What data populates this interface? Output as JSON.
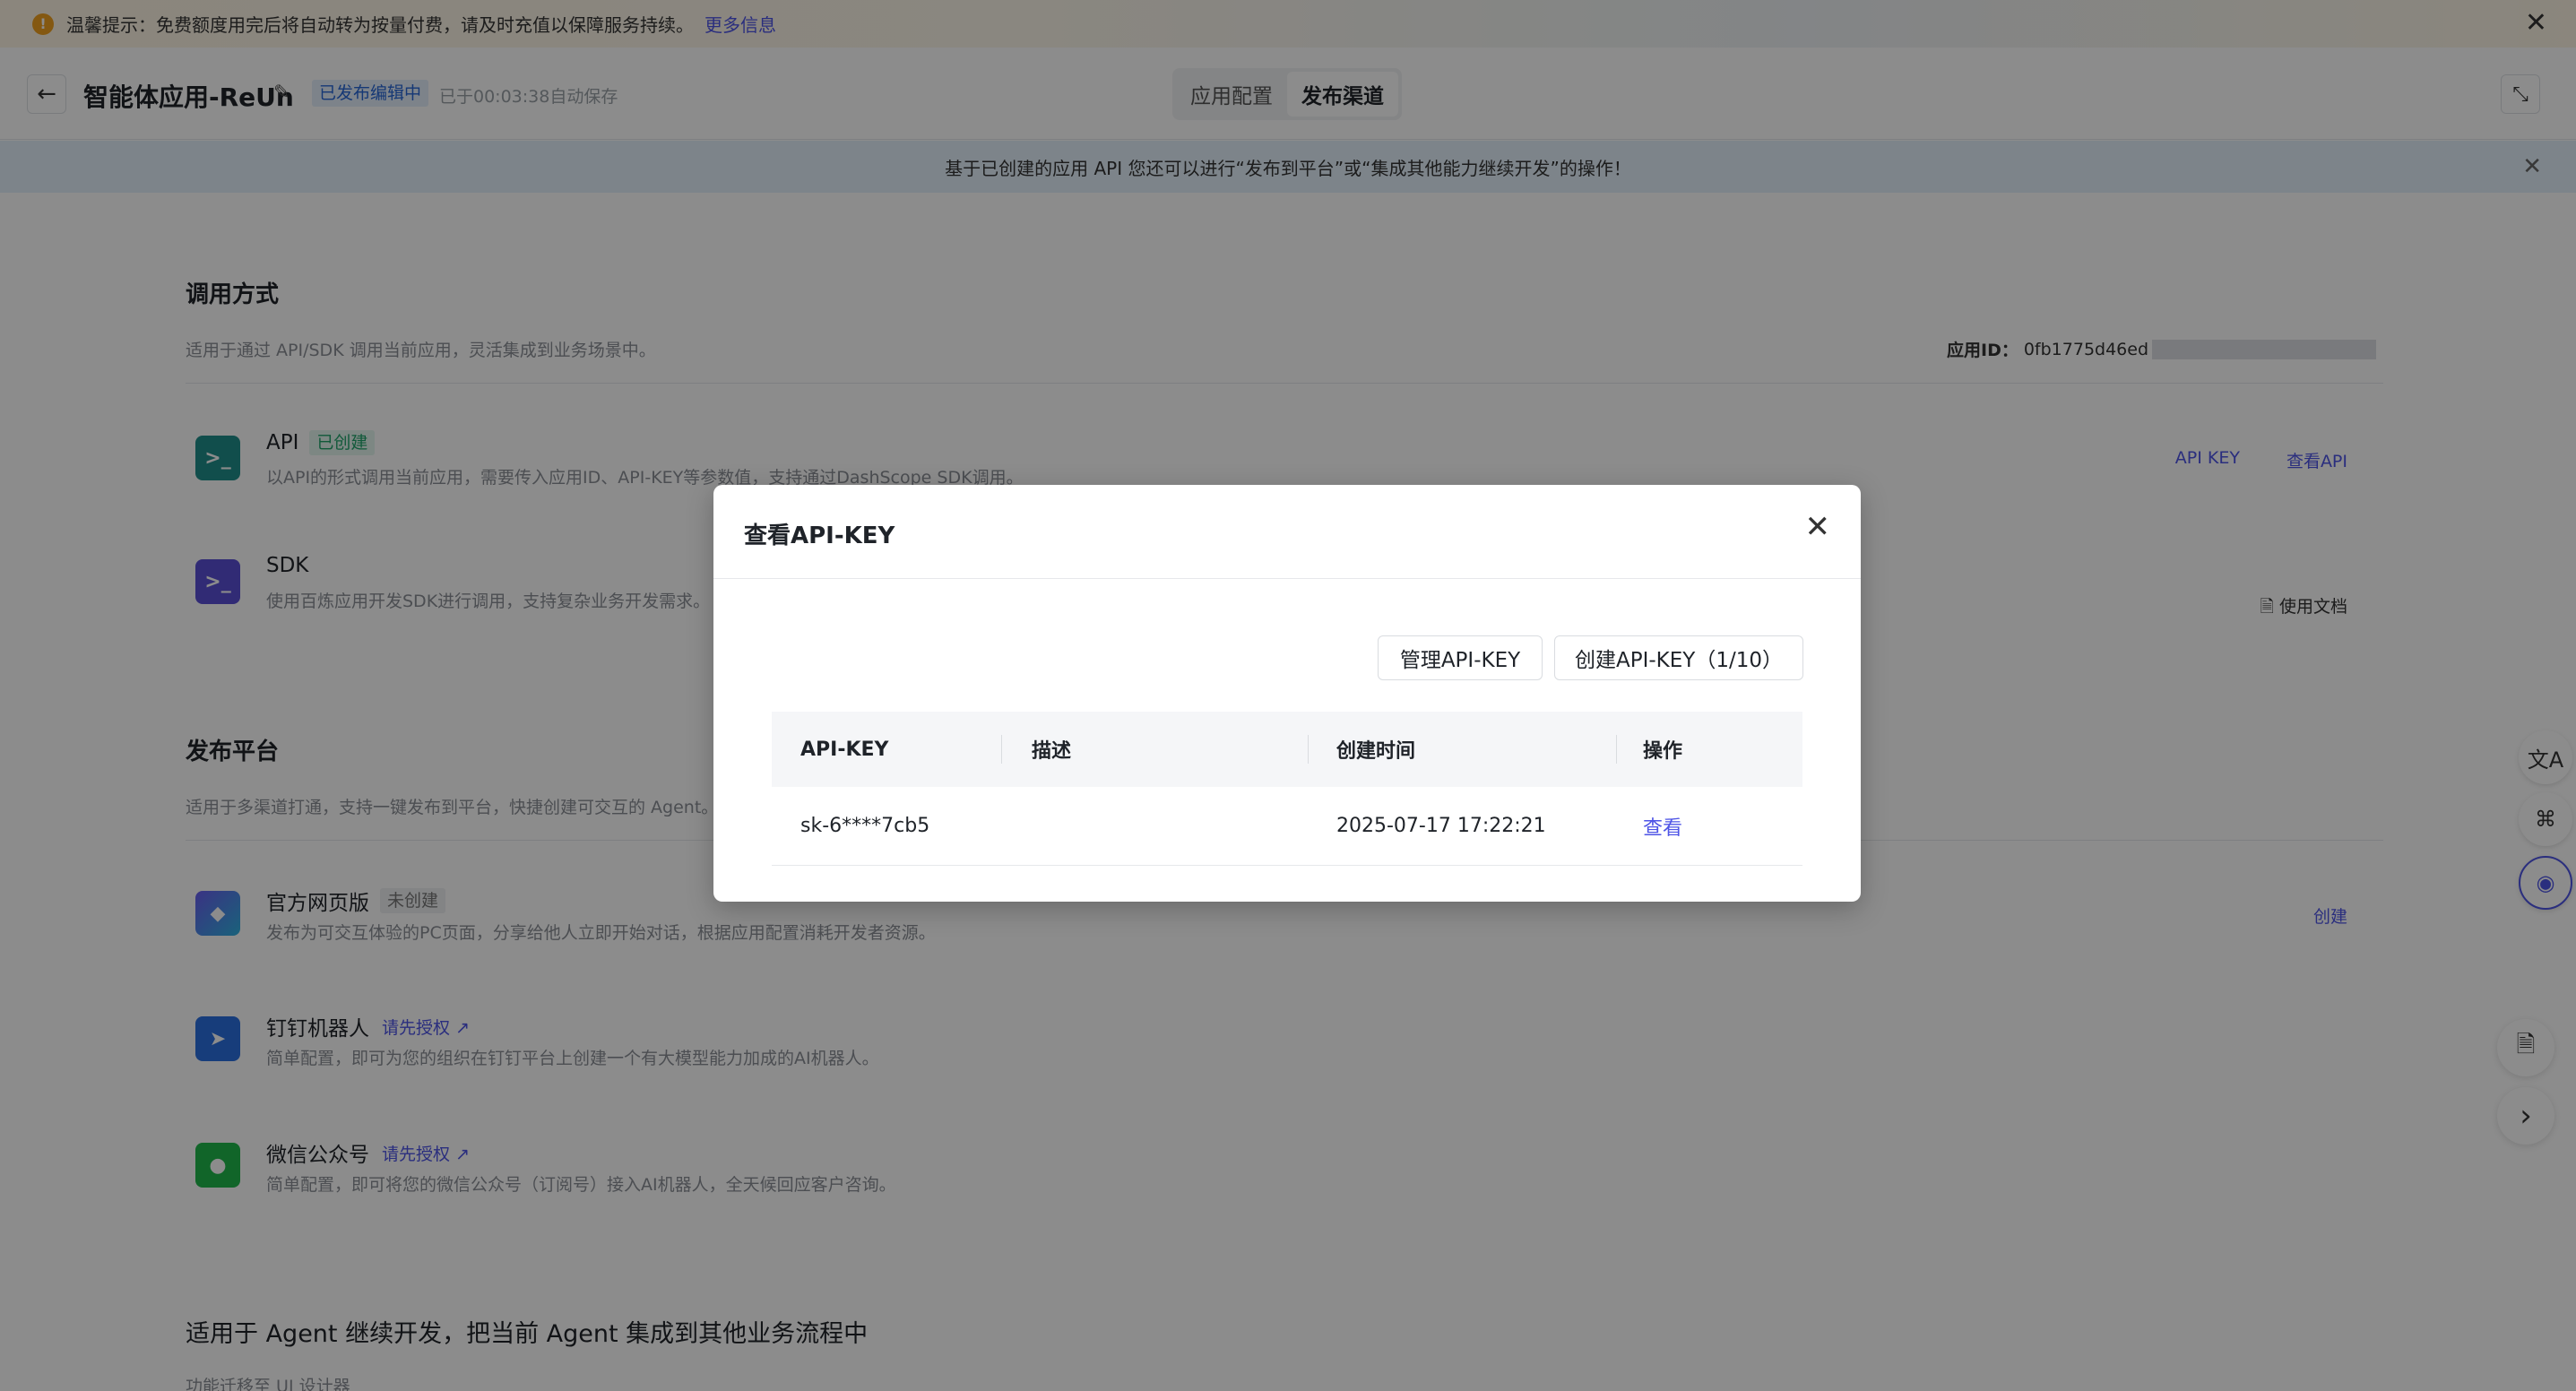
{
  "warning_banner": {
    "icon": "!",
    "text": "温馨提示：免费额度用完后将自动转为按量付费，请及时充值以保障服务持续。",
    "link": "更多信息",
    "close": "✕"
  },
  "header": {
    "back": "←",
    "title": "智能体应用-ReUn",
    "edit": "✎",
    "status_badge": "已发布编辑中",
    "autosave": "已于00:03:38自动保存",
    "tabs": [
      {
        "label": "应用配置",
        "active": false
      },
      {
        "label": "发布渠道",
        "active": true
      }
    ],
    "expand": "⤡"
  },
  "info_banner": {
    "text": "基于已创建的应用 API 您还可以进行“发布到平台”或“集成其他能力继续开发”的操作！",
    "close": "✕"
  },
  "invoke": {
    "title": "调用方式",
    "desc": "适用于通过 API/SDK 调用当前应用，灵活集成到业务场景中。",
    "app_id_label": "应用ID：",
    "app_id_value": "0fb1775d46ed",
    "items": [
      {
        "icon": ">_",
        "name": "API",
        "tag": "已创建",
        "desc": "以API的形式调用当前应用，需要传入应用ID、API-KEY等参数值，支持通过DashScope SDK调用。",
        "actions": [
          "API KEY",
          "查看API"
        ]
      },
      {
        "icon": ">_",
        "name": "SDK",
        "desc": "使用百炼应用开发SDK进行调用，支持复杂业务开发需求。",
        "action": "使用文档",
        "action_icon": "🗎"
      }
    ]
  },
  "publish": {
    "title": "发布平台",
    "desc": "适用于多渠道打通，支持一键发布到平台，快捷创建可交互的 Agent。",
    "items": [
      {
        "icon": "◆",
        "name": "官方网页版",
        "tag": "未创建",
        "desc": "发布为可交互体验的PC页面，分享给他人立即开始对话，根据应用配置消耗开发者资源。",
        "action": "创建"
      },
      {
        "icon": "➤",
        "name": "钉钉机器人",
        "auth": "请先授权 ↗",
        "desc": "简单配置，即可为您的组织在钉钉平台上创建一个有大模型能力加成的AI机器人。"
      },
      {
        "icon": "●",
        "name": "微信公众号",
        "auth": "请先授权 ↗",
        "desc": "简单配置，即可将您的微信公众号（订阅号）接入AI机器人，全天候回应客户咨询。"
      }
    ]
  },
  "integrate": {
    "title": "适用于 Agent 继续开发，把当前 Agent 集成到其他业务流程中",
    "desc": "功能迁移至 UI 设计器"
  },
  "side_tools": {
    "translate": "文A",
    "apps": "⌘",
    "assistant": "◉",
    "doc": "🗎",
    "next": "›"
  },
  "modal": {
    "title": "查看API-KEY",
    "close": "✕",
    "manage_button": "管理API-KEY",
    "create_button": "创建API-KEY（1/10）",
    "columns": [
      "API-KEY",
      "描述",
      "创建时间",
      "操作"
    ],
    "rows": [
      {
        "key": "sk-6****7cb5",
        "desc": "",
        "created": "2025-07-17 17:22:21",
        "action": "查看"
      }
    ]
  },
  "colors": {
    "accent": "#4e54e6",
    "success": "#1fa36a",
    "status_blue": "#2766d6"
  }
}
